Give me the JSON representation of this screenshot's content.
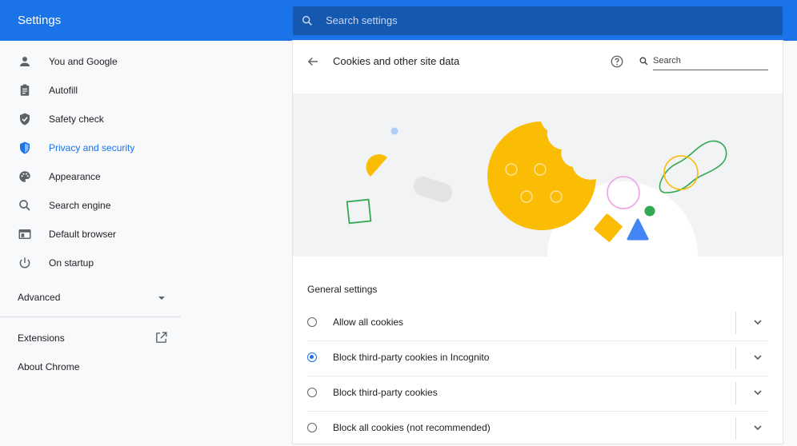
{
  "header": {
    "title": "Settings",
    "search_placeholder": "Search settings"
  },
  "sidebar": {
    "items": [
      {
        "label": "You and Google",
        "icon": "person-icon"
      },
      {
        "label": "Autofill",
        "icon": "clipboard-icon"
      },
      {
        "label": "Safety check",
        "icon": "shield-check-icon"
      },
      {
        "label": "Privacy and security",
        "icon": "shield-icon",
        "active": true
      },
      {
        "label": "Appearance",
        "icon": "palette-icon"
      },
      {
        "label": "Search engine",
        "icon": "search-icon"
      },
      {
        "label": "Default browser",
        "icon": "browser-icon"
      },
      {
        "label": "On startup",
        "icon": "power-icon"
      }
    ],
    "advanced_label": "Advanced",
    "extensions_label": "Extensions",
    "about_label": "About Chrome"
  },
  "page": {
    "title": "Cookies and other site data",
    "search_placeholder": "Search",
    "section_title": "General settings",
    "options": [
      {
        "label": "Allow all cookies",
        "checked": false
      },
      {
        "label": "Block third-party cookies in Incognito",
        "checked": true
      },
      {
        "label": "Block third-party cookies",
        "checked": false
      },
      {
        "label": "Block all cookies (not recommended)",
        "checked": false
      }
    ]
  },
  "colors": {
    "accent": "#1a73e8",
    "header_bg": "#1a73e8",
    "search_bg": "#1558b0",
    "cookie_yellow": "#fbbc04",
    "green": "#34a853",
    "pink": "#f0a8e8"
  }
}
